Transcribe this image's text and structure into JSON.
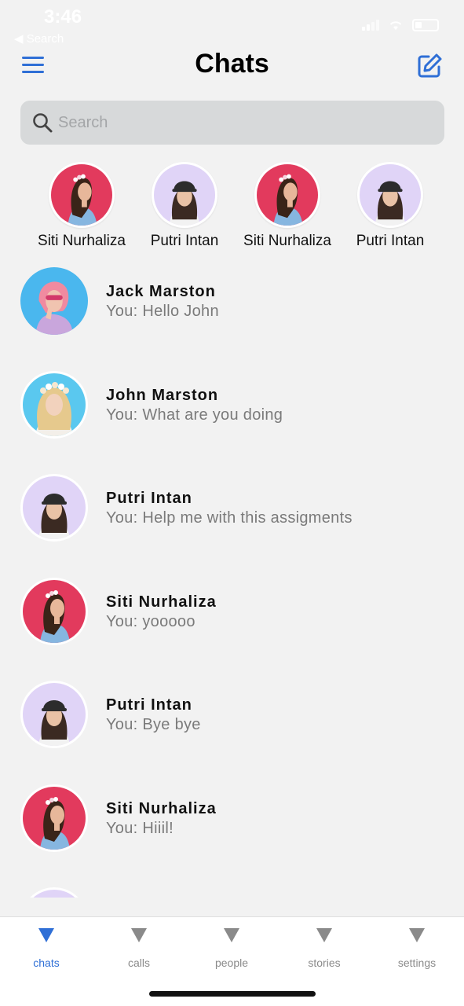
{
  "status_bar": {
    "time": "3:46",
    "back_label": "◀ Search"
  },
  "header": {
    "title": "Chats",
    "menu_icon": "hamburger-icon",
    "compose_icon": "compose-icon"
  },
  "search": {
    "placeholder": "Search",
    "value": ""
  },
  "stories": [
    {
      "name": "Siti Nurhaliza",
      "avatar": "pink"
    },
    {
      "name": "Putri Intan",
      "avatar": "lavender"
    },
    {
      "name": "Siti Nurhaliza",
      "avatar": "pink"
    },
    {
      "name": "Putri Intan",
      "avatar": "lavender"
    }
  ],
  "chats": [
    {
      "name": "Jack Marston",
      "message": "You: Hello John",
      "avatar": "sky"
    },
    {
      "name": "John Marston",
      "message": "You: What are you doing",
      "avatar": "cyan"
    },
    {
      "name": "Putri Intan",
      "message": "You: Help me with this assigments",
      "avatar": "lavender"
    },
    {
      "name": "Siti Nurhaliza",
      "message": "You: yooooo",
      "avatar": "pink"
    },
    {
      "name": "Putri Intan",
      "message": "You: Bye bye",
      "avatar": "lavender"
    },
    {
      "name": "Siti Nurhaliza",
      "message": "You: Hiiil!",
      "avatar": "pink"
    },
    {
      "name": "",
      "message": "",
      "avatar": "lavender"
    }
  ],
  "tabs": [
    {
      "label": "chats",
      "active": true
    },
    {
      "label": "calls",
      "active": false
    },
    {
      "label": "people",
      "active": false
    },
    {
      "label": "stories",
      "active": false
    },
    {
      "label": "settings",
      "active": false
    }
  ],
  "colors": {
    "accent": "#2f6fd6",
    "background": "#f2f2f2",
    "search_bg": "#d7d9da",
    "avatar_pink": "#e23a5d",
    "avatar_lavender": "#e0d4f7",
    "avatar_sky": "#4ab7ee",
    "avatar_cyan": "#5ac8ef"
  }
}
